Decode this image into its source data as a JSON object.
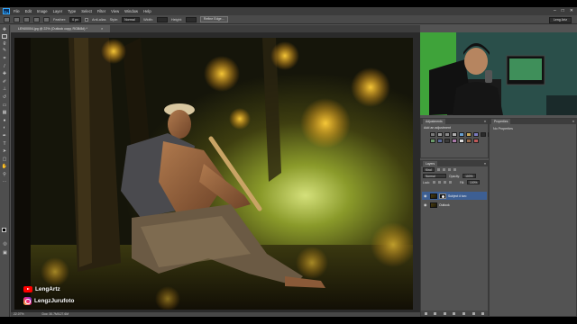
{
  "menubar": {
    "logo": "Ps",
    "items": [
      "File",
      "Edit",
      "Image",
      "Layer",
      "Type",
      "Select",
      "Filter",
      "View",
      "Window",
      "Help"
    ],
    "window_controls": [
      "–",
      "□",
      "✕"
    ]
  },
  "options": {
    "feather_label": "Feather:",
    "feather_value": "0 px",
    "antialias_label": "Anti-alias",
    "style_label": "Style:",
    "style_value": "Normal",
    "width_label": "Width:",
    "height_label": "Height:",
    "refine_label": "Refine Edge...",
    "workspace": "Leng Artz"
  },
  "document": {
    "tab_title": "LEN00004.jpg @ 22% (Outlook copy, RGB/8#) *",
    "close": "×"
  },
  "status": {
    "zoom": "22.07%",
    "doc": "Doc: 30.7M/127.6M"
  },
  "watermark": {
    "youtube": "LengArtz",
    "instagram": "LengzJurufoto"
  },
  "adjustments": {
    "tab": "Adjustments",
    "title": "Add an adjustment",
    "icons": [
      "brightness-icon",
      "levels-icon",
      "curves-icon",
      "exposure-icon",
      "vibrance-icon",
      "hue-saturation-icon",
      "color-balance-icon",
      "black-white-icon",
      "photo-filter-icon",
      "channel-mixer-icon",
      "color-lookup-icon",
      "invert-icon",
      "posterize-icon",
      "threshold-icon",
      "gradient-map-icon",
      "selective-color-icon"
    ],
    "colors": [
      "#7a7a7a",
      "#9a9a9a",
      "#8a8a8a",
      "#b0b0b0",
      "#6aa0d0",
      "#c7a85a",
      "#7a7ac0",
      "#2a2a2a",
      "#d8a040",
      "#6a9a6a",
      "#5a6a9a",
      "#3a3a3a",
      "#aa7aaa",
      "#dcdcdc",
      "#9a6a4a",
      "#c05a5a"
    ]
  },
  "properties": {
    "tab": "Properties",
    "body": "No Properties"
  },
  "layers": {
    "tab": "Layers",
    "kind": "Kind",
    "blend": "Normal",
    "opacity_label": "Opacity:",
    "opacity_value": "100%",
    "lock_label": "Lock:",
    "fill_label": "Fill:",
    "fill_value": "100%",
    "items": [
      {
        "name": "Subject # two",
        "selected": true
      },
      {
        "name": "Outlook",
        "selected": false
      }
    ]
  },
  "colors": {
    "app_bg": "#535353",
    "menubar_bg": "#3c3c3c",
    "selected_layer": "#3d5f93"
  }
}
